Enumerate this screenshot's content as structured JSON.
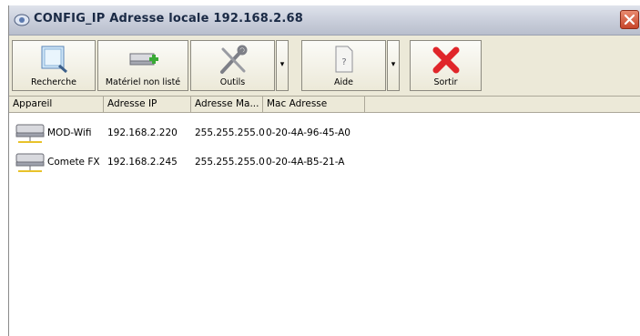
{
  "window": {
    "title": "CONFIG_IP Adresse locale 192.168.2.68"
  },
  "toolbar": {
    "buttons": [
      {
        "label": "Recherche",
        "icon": "magnifier-icon"
      },
      {
        "label": "Matériel non listé",
        "icon": "add-hardware-icon"
      },
      {
        "label": "Outils",
        "icon": "tools-icon"
      },
      {
        "label": "Aide",
        "icon": "help-icon"
      },
      {
        "label": "Sortir",
        "icon": "exit-icon"
      }
    ]
  },
  "list": {
    "columns": [
      "Appareil",
      "Adresse IP",
      "Adresse Ma...",
      "Mac Adresse"
    ],
    "rows": [
      {
        "device": "MOD-Wifi",
        "ip": "192.168.2.220",
        "mask": "255.255.255.0",
        "mac": "0-20-4A-96-45-A0"
      },
      {
        "device": "Comete FX",
        "ip": "192.168.2.245",
        "mask": "255.255.255.0",
        "mac": "0-20-4A-B5-21-A"
      }
    ]
  },
  "colors": {
    "exit_red": "#e0262a",
    "add_green": "#3aaa35",
    "title_text": "#1a2a45"
  }
}
